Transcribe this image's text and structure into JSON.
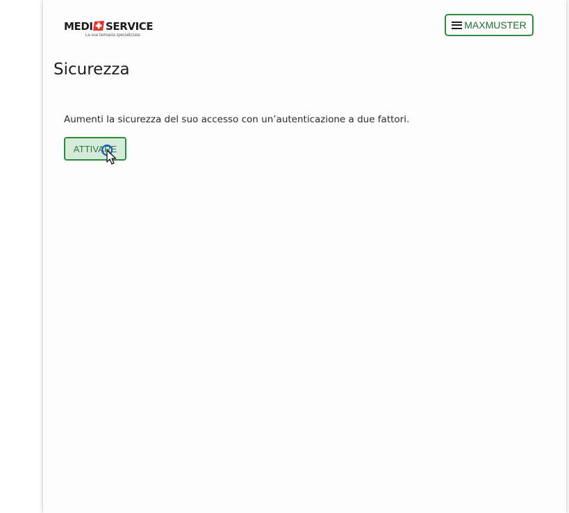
{
  "header": {
    "logo_left": "MEDI",
    "logo_right": "SERVICE",
    "logo_tagline": "La sua farmacia specializzata",
    "menu_label": "MAXMUSTER"
  },
  "page": {
    "title": "Sicurezza",
    "description": "Aumenti la sicurezza del suo accesso con un’autenticazione a due fattori.",
    "activate_label": "ATTIVARE"
  },
  "colors": {
    "accent_green": "#2b8a3e",
    "logo_red": "#e5332a",
    "button_fill": "#d6ebd9"
  },
  "icons": {
    "menu": "hamburger-icon",
    "logo": "swiss-cross-icon",
    "pointer": "mouse-cursor-icon"
  }
}
